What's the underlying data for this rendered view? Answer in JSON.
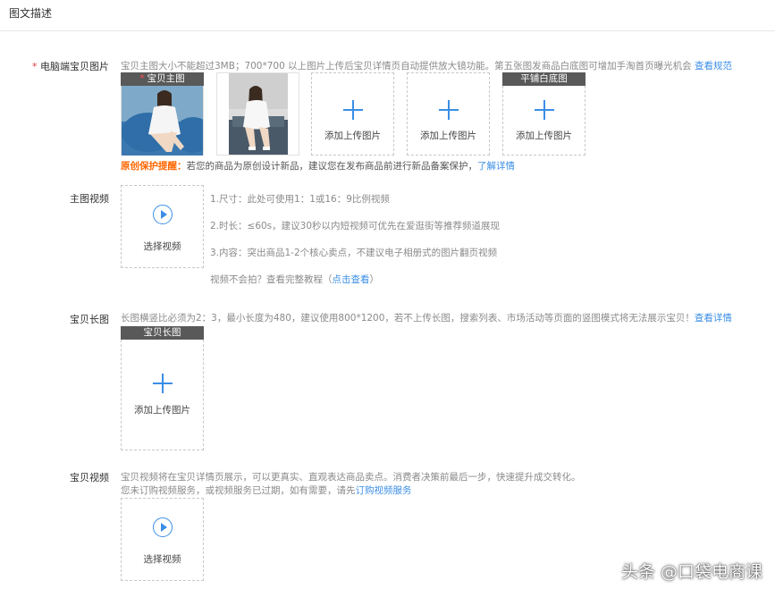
{
  "section": {
    "title": "图文描述"
  },
  "main_images": {
    "required_mark": "*",
    "label": "电脑端宝贝图片",
    "hint": "宝贝主图大小不能超过3MB；700*700 以上图片上传后宝贝详情页自动提供放大镜功能。第五张图发商品白底图可增加手淘首页曝光机会",
    "hint_link": "查看规范",
    "slots": [
      {
        "caption": "宝贝主图",
        "caption_required": "*",
        "state": "image"
      },
      {
        "caption": "",
        "state": "image"
      },
      {
        "caption": "",
        "state": "empty",
        "text": "添加上传图片"
      },
      {
        "caption": "",
        "state": "empty",
        "text": "添加上传图片"
      },
      {
        "caption": "平铺白底图",
        "state": "empty",
        "text": "添加上传图片"
      }
    ],
    "protect_title": "原创保护提醒：",
    "protect_text": "若您的商品为原创设计新品，建议您在发布商品前进行新品备案保护，",
    "protect_link": "了解详情"
  },
  "main_video": {
    "label": "主图视频",
    "upload_text": "选择视频",
    "rules": [
      "1.尺寸：此处可使用1：1或16：9比例视频",
      "2.时长：≤60s，建议30秒以内短视频可优先在爱逛街等推荐频道展现",
      "3.内容：突出商品1-2个核心卖点，不建议电子相册式的图片翻页视频"
    ],
    "tutorial_prefix": "视频不会拍？查看完整教程（",
    "tutorial_link": "点击查看",
    "tutorial_suffix": "）"
  },
  "long_image": {
    "label": "宝贝长图",
    "hint": "长图横竖比必须为2：3，最小长度为480，建议使用800*1200，若不上传长图，搜索列表、市场活动等页面的竖图模式将无法展示宝贝！",
    "hint_link": "查看详情",
    "caption": "宝贝长图",
    "upload_text": "添加上传图片"
  },
  "item_video": {
    "label": "宝贝视频",
    "hint_line1": "宝贝视频将在宝贝详情页展示，可以更真实、直观表达商品卖点。消费者决策前最后一步，快速提升成交转化。",
    "hint_line2_prefix": "您未订购视频服务，或视频服务已过期，如有需要，请先",
    "hint_line2_link": "订购视频服务",
    "upload_text": "选择视频"
  },
  "watermark": {
    "text": "头条 @口袋电商课"
  },
  "colors": {
    "link": "#3a8ee6",
    "required": "#e4393c",
    "warning": "#ff6600",
    "caption_bg": "#595959"
  }
}
